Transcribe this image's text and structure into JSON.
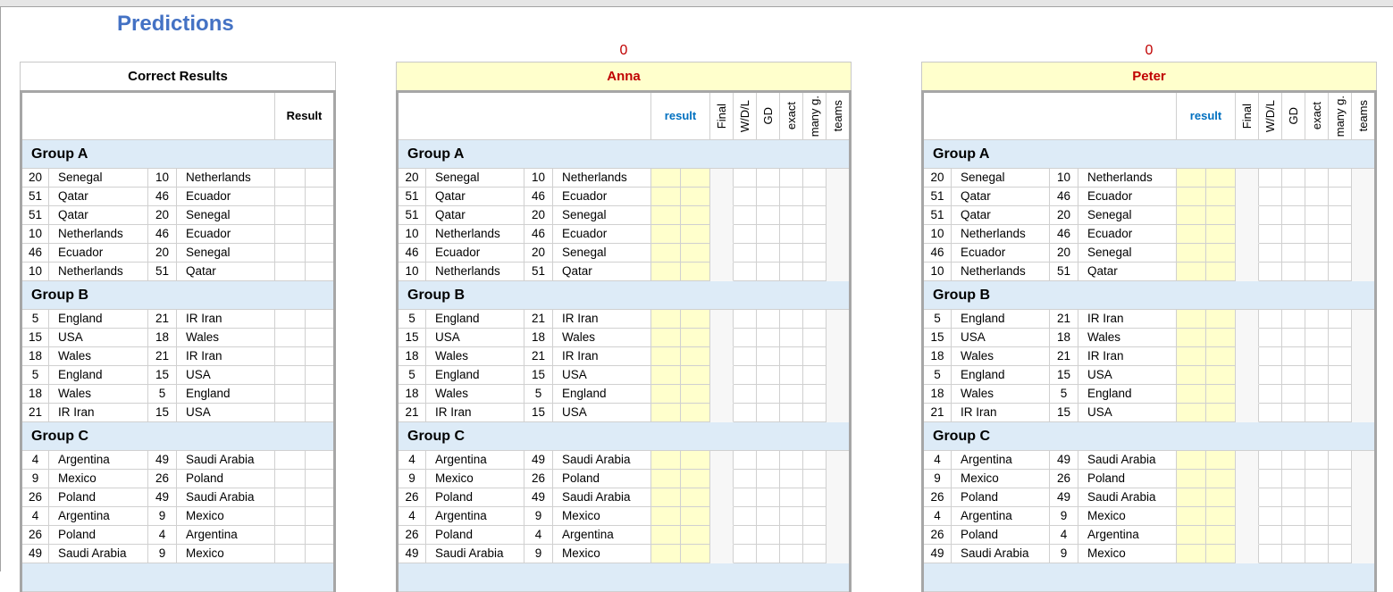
{
  "title": "Predictions",
  "colors": {
    "title": "#4472C4",
    "player_name": "#C00000",
    "score": "#C00000",
    "result_header": "#0070C0",
    "prediction_fill": "#FFFFCC",
    "group_fill": "#DDEBF7",
    "points_shaded_fill": "#F7F7F7"
  },
  "correct_results": {
    "heading": "Correct Results",
    "result_header": "Result"
  },
  "players": [
    {
      "name": "Anna",
      "total_points": "0",
      "result_header": "result"
    },
    {
      "name": "Peter",
      "total_points": "0",
      "result_header": "result"
    }
  ],
  "point_columns": [
    "Final",
    "W/D/L",
    "GD",
    "exact",
    "many g.",
    "teams"
  ],
  "groups": [
    {
      "name": "Group A",
      "matches": [
        {
          "home_rank": "20",
          "home": "Senegal",
          "away_rank": "10",
          "away": "Netherlands"
        },
        {
          "home_rank": "51",
          "home": "Qatar",
          "away_rank": "46",
          "away": "Ecuador"
        },
        {
          "home_rank": "51",
          "home": "Qatar",
          "away_rank": "20",
          "away": "Senegal"
        },
        {
          "home_rank": "10",
          "home": "Netherlands",
          "away_rank": "46",
          "away": "Ecuador"
        },
        {
          "home_rank": "46",
          "home": "Ecuador",
          "away_rank": "20",
          "away": "Senegal"
        },
        {
          "home_rank": "10",
          "home": "Netherlands",
          "away_rank": "51",
          "away": "Qatar"
        }
      ]
    },
    {
      "name": "Group B",
      "matches": [
        {
          "home_rank": "5",
          "home": "England",
          "away_rank": "21",
          "away": "IR Iran"
        },
        {
          "home_rank": "15",
          "home": "USA",
          "away_rank": "18",
          "away": "Wales"
        },
        {
          "home_rank": "18",
          "home": "Wales",
          "away_rank": "21",
          "away": "IR Iran"
        },
        {
          "home_rank": "5",
          "home": "England",
          "away_rank": "15",
          "away": "USA"
        },
        {
          "home_rank": "18",
          "home": "Wales",
          "away_rank": "5",
          "away": "England"
        },
        {
          "home_rank": "21",
          "home": "IR Iran",
          "away_rank": "15",
          "away": "USA"
        }
      ]
    },
    {
      "name": "Group C",
      "matches": [
        {
          "home_rank": "4",
          "home": "Argentina",
          "away_rank": "49",
          "away": "Saudi Arabia"
        },
        {
          "home_rank": "9",
          "home": "Mexico",
          "away_rank": "26",
          "away": "Poland"
        },
        {
          "home_rank": "26",
          "home": "Poland",
          "away_rank": "49",
          "away": "Saudi Arabia"
        },
        {
          "home_rank": "4",
          "home": "Argentina",
          "away_rank": "9",
          "away": "Mexico"
        },
        {
          "home_rank": "26",
          "home": "Poland",
          "away_rank": "4",
          "away": "Argentina"
        },
        {
          "home_rank": "49",
          "home": "Saudi Arabia",
          "away_rank": "9",
          "away": "Mexico"
        }
      ]
    }
  ]
}
